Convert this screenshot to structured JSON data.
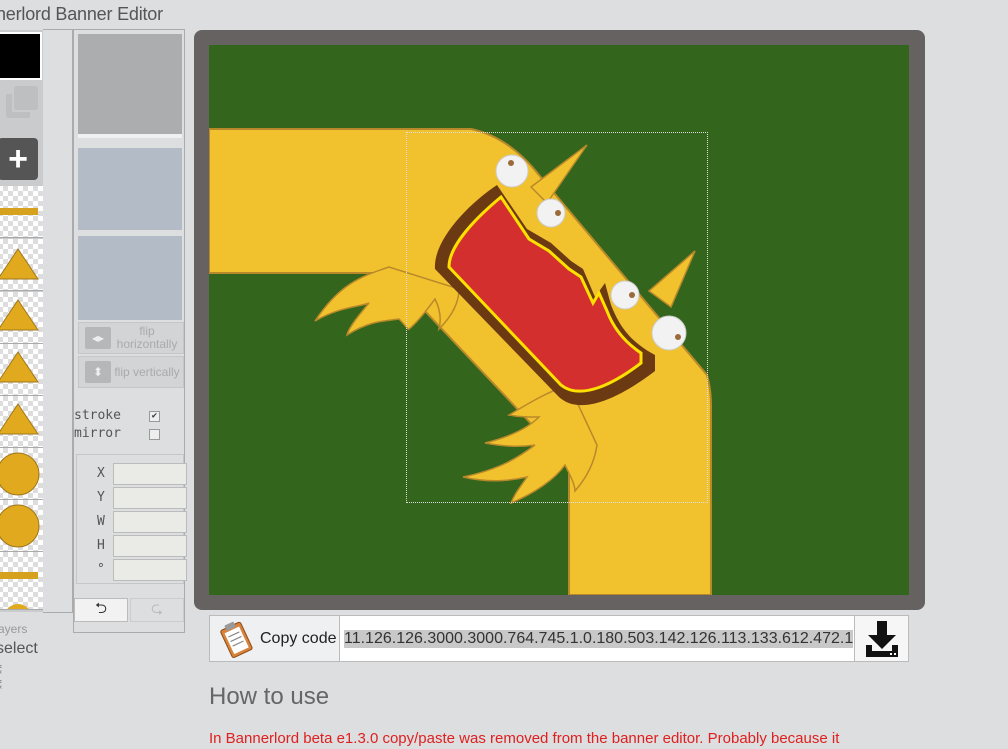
{
  "app": {
    "title": "nerlord Banner Editor"
  },
  "layers": {
    "footer_label": "ayers",
    "select_label": "select",
    "items": [
      {
        "shape": "bar"
      },
      {
        "shape": "triangle"
      },
      {
        "shape": "triangle"
      },
      {
        "shape": "triangle"
      },
      {
        "shape": "triangle"
      },
      {
        "shape": "circle"
      },
      {
        "shape": "circle"
      },
      {
        "shape": "bar"
      }
    ]
  },
  "props": {
    "flip_h_label": "flip horizontally",
    "flip_v_label": "flip vertically",
    "stroke_label": "stroke",
    "stroke_checked": "✔",
    "mirror_label": "mirror",
    "mirror_checked": "",
    "x_label": "X",
    "y_label": "Y",
    "w_label": "W",
    "h_label": "H",
    "deg_label": "°",
    "undo_icon": "⮌",
    "redo_icon": "⮎"
  },
  "canvas": {
    "background_color": "#33651c",
    "frame_color": "#666262"
  },
  "code": {
    "copy_label": "Copy code",
    "value": "11.126.126.3000.3000.764.745.1.0.180.503.142.126.113.133.612.472.1"
  },
  "content": {
    "howto_title": "How to use",
    "notice": "In Bannerlord beta e1.3.0 copy/paste was removed from the banner editor. Probably because it"
  },
  "colors": {
    "yellow": "#f2c12e",
    "red": "#d32f2f",
    "brown": "#6b3a12",
    "notice": "#e02020"
  }
}
